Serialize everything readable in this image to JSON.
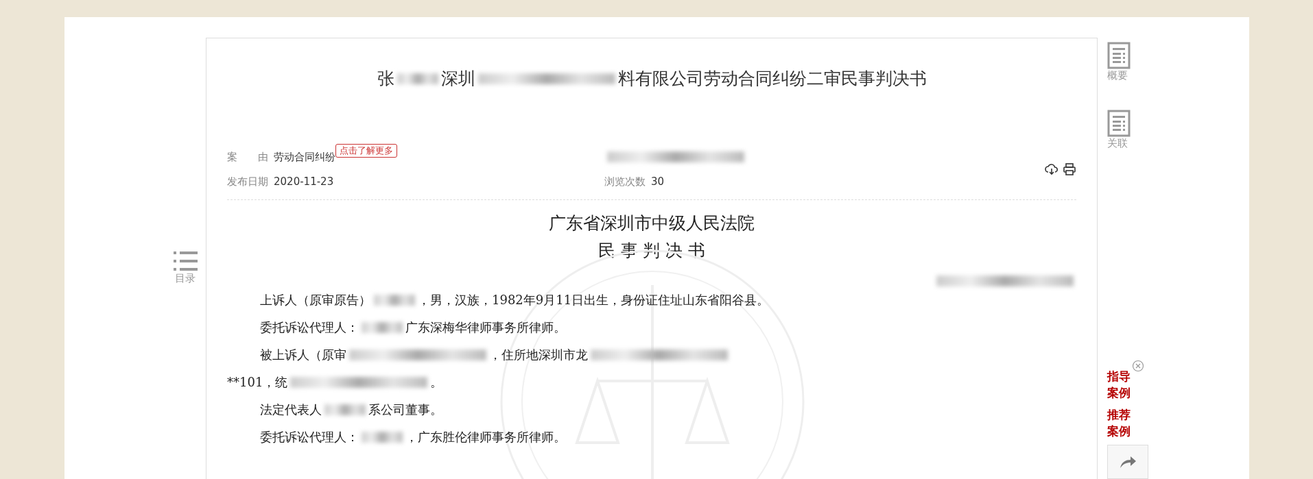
{
  "title": {
    "parts": [
      {
        "kind": "text",
        "text": "张"
      },
      {
        "kind": "blur"
      },
      {
        "kind": "text",
        "text": "深圳"
      },
      {
        "kind": "wideblur"
      },
      {
        "kind": "text",
        "text": "料有限公司劳动合同纠纷二审民事判决书"
      }
    ]
  },
  "meta": [
    {
      "kind": "cause",
      "label": "案　　由",
      "value": "劳动合同纠纷",
      "tag": "点击了解更多"
    },
    {
      "kind": "redacted"
    },
    {
      "kind": "field",
      "label": "发布日期",
      "value": "2020-11-23"
    },
    {
      "kind": "field",
      "label": "浏览次数",
      "value": "30"
    }
  ],
  "actions": [
    {
      "kind": "download"
    },
    {
      "kind": "print"
    }
  ],
  "court": {
    "name": "广东省深圳市中级人民法院",
    "doc_type": "民 事 判 决 书"
  },
  "paragraphs": [
    {
      "kind": "right",
      "parts": [
        {
          "kind": "wideblur"
        }
      ]
    },
    {
      "kind": "indented",
      "parts": [
        {
          "kind": "text",
          "text": "上诉人（原审原告）"
        },
        {
          "kind": "blur"
        },
        {
          "kind": "text",
          "text": "，男，汉族，1982年9月11日出生，身份证住址山东省阳谷县。"
        }
      ]
    },
    {
      "kind": "indented",
      "parts": [
        {
          "kind": "text",
          "text": "委托诉讼代理人："
        },
        {
          "kind": "blur"
        },
        {
          "kind": "text",
          "text": "广东深梅华律师事务所律师。"
        }
      ]
    },
    {
      "kind": "indented",
      "parts": [
        {
          "kind": "text",
          "text": "被上诉人（原审"
        },
        {
          "kind": "wideblur"
        },
        {
          "kind": "text",
          "text": "，住所地深圳市龙"
        },
        {
          "kind": "wideblur"
        }
      ]
    },
    {
      "kind": "flush",
      "parts": [
        {
          "kind": "text",
          "text": "**101，统"
        },
        {
          "kind": "wideblur"
        },
        {
          "kind": "text",
          "text": "。"
        }
      ]
    },
    {
      "kind": "indented",
      "parts": [
        {
          "kind": "text",
          "text": "法定代表人"
        },
        {
          "kind": "blur"
        },
        {
          "kind": "text",
          "text": "系公司董事。"
        }
      ]
    },
    {
      "kind": "indented",
      "parts": [
        {
          "kind": "text",
          "text": "委托诉讼代理人："
        },
        {
          "kind": "blur"
        },
        {
          "kind": "text",
          "text": "，广东胜伦律师事务所律师。"
        }
      ]
    }
  ],
  "toc": {
    "label": "目录"
  },
  "sidebar": {
    "items": [
      {
        "label": "概要"
      },
      {
        "label": "关联"
      }
    ],
    "promos": [
      {
        "label": "指导案例"
      },
      {
        "label": "推荐案例"
      }
    ]
  }
}
